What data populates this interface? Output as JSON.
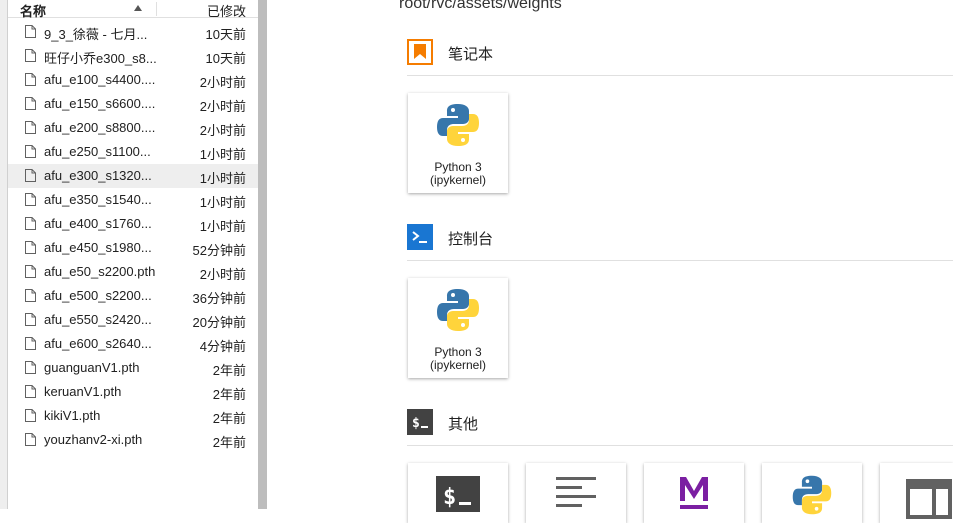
{
  "file_browser": {
    "header": {
      "name_label": "名称",
      "modified_label": "已修改"
    },
    "files": [
      {
        "name": "9_3_徐薇 - 七月...",
        "modified": "10天前"
      },
      {
        "name": "旺仔小乔e300_s8...",
        "modified": "10天前"
      },
      {
        "name": "afu_e100_s4400....",
        "modified": "2小时前"
      },
      {
        "name": "afu_e150_s6600....",
        "modified": "2小时前"
      },
      {
        "name": "afu_e200_s8800....",
        "modified": "2小时前"
      },
      {
        "name": "afu_e250_s1100...",
        "modified": "1小时前"
      },
      {
        "name": "afu_e300_s1320...",
        "modified": "1小时前"
      },
      {
        "name": "afu_e350_s1540...",
        "modified": "1小时前"
      },
      {
        "name": "afu_e400_s1760...",
        "modified": "1小时前"
      },
      {
        "name": "afu_e450_s1980...",
        "modified": "52分钟前"
      },
      {
        "name": "afu_e50_s2200.pth",
        "modified": "2小时前"
      },
      {
        "name": "afu_e500_s2200...",
        "modified": "36分钟前"
      },
      {
        "name": "afu_e550_s2420...",
        "modified": "20分钟前"
      },
      {
        "name": "afu_e600_s2640...",
        "modified": "4分钟前"
      },
      {
        "name": "guanguanV1.pth",
        "modified": "2年前"
      },
      {
        "name": "keruanV1.pth",
        "modified": "2年前"
      },
      {
        "name": "kikiV1.pth",
        "modified": "2年前"
      },
      {
        "name": "youzhanv2-xi.pth",
        "modified": "2年前"
      }
    ]
  },
  "launcher": {
    "path": "root/rvc/assets/weights",
    "sections": {
      "notebook": {
        "title": "笔记本",
        "card": {
          "line1": "Python 3",
          "line2": "(ipykernel)"
        }
      },
      "console": {
        "title": "控制台",
        "card": {
          "line1": "Python 3",
          "line2": "(ipykernel)"
        }
      },
      "other": {
        "title": "其他"
      }
    }
  },
  "colors": {
    "notebook_icon": "#f57c00",
    "console_icon": "#1976d2",
    "other_icon": "#424242",
    "markdown_icon": "#7b1fa2",
    "python_blue": "#3776ab",
    "python_yellow": "#ffd43b"
  }
}
